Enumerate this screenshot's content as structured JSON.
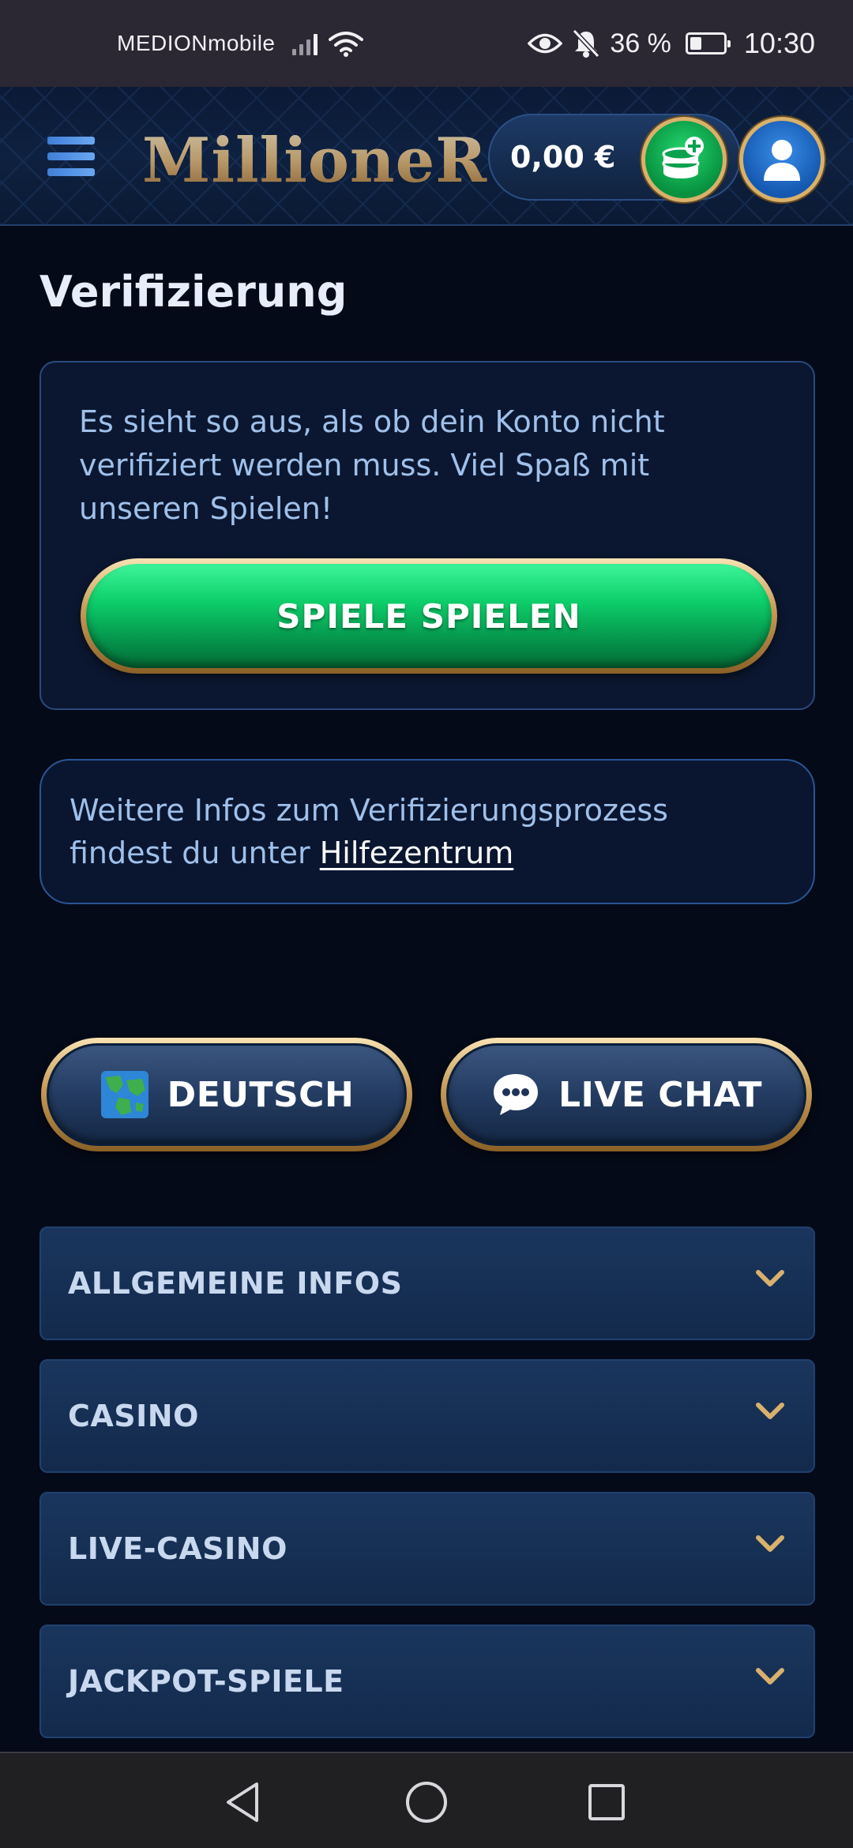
{
  "status_bar": {
    "carrier": "MEDIONmobile",
    "battery_percent": "36 %",
    "battery_level": 0.36,
    "time": "10:30"
  },
  "header": {
    "logo_text": "MillioneR",
    "balance": "0,00 €"
  },
  "page": {
    "title": "Verifizierung"
  },
  "verification_card": {
    "message": "Es sieht so aus, als ob dein Konto nicht verifiziert werden muss. Viel Spaß mit unseren Spielen!",
    "play_button": "SPIELE SPIELEN"
  },
  "info_card": {
    "text_before_link": "Weitere Infos zum Verifizierungsprozess findest du unter ",
    "link": "Hilfezentrum"
  },
  "actions": {
    "language_button": "DEUTSCH",
    "chat_button": "LIVE CHAT"
  },
  "accordion": [
    {
      "label": "ALLGEMEINE INFOS"
    },
    {
      "label": "CASINO"
    },
    {
      "label": "LIVE-CASINO"
    },
    {
      "label": "JACKPOT-SPIELE"
    }
  ],
  "colors": {
    "background": "#050a18",
    "accent_gold": "#d8b16c",
    "accent_green": "#0dd06b",
    "accent_blue": "#1a355d"
  }
}
